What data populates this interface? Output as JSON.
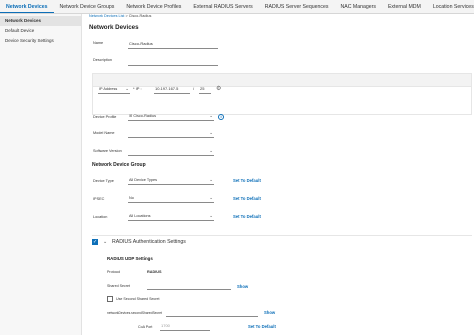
{
  "tabs": [
    "Network Devices",
    "Network Device Groups",
    "Network Device Profiles",
    "External RADIUS Servers",
    "RADIUS Server Sequences",
    "NAC Managers",
    "External MDM",
    "Location Services"
  ],
  "sidebar": {
    "items": [
      "Network Devices",
      "Default Device",
      "Device Security Settings"
    ]
  },
  "breadcrumb": {
    "link": "Network Devices List",
    "sep": ">",
    "current": "Cisco-Radius"
  },
  "page_title": "Network Devices",
  "form": {
    "name_label": "Name",
    "name_value": "Cisco-Radius",
    "description_label": "Description",
    "description_value": "",
    "ip": {
      "type": "IP Address",
      "sep": "* IP :",
      "address": "10.197.167.5",
      "slash": "/",
      "mask": "25"
    },
    "device_profile_label": "Device Profile",
    "device_profile_value": "Cisco-Radius",
    "model_name_label": "Model Name",
    "software_version_label": "Software Version"
  },
  "ndg": {
    "title": "Network Device Group",
    "device_type_label": "Device Type",
    "device_type_value": "All Device Types",
    "ipsec_label": "IPSEC",
    "ipsec_value": "No",
    "location_label": "Location",
    "location_value": "All Locations",
    "set_default": "Set To Default"
  },
  "radius": {
    "section_title": "RADIUS Authentication Settings",
    "udp_title": "RADIUS UDP Settings",
    "protocol_label": "Protocol",
    "protocol_value": "RADIUS",
    "shared_secret_label": "Shared Secret",
    "shared_secret_value": "",
    "show": "Show",
    "second_secret_label": "Use Second Shared Secret",
    "second_secret_field": "networkDevices.secondSharedSecret",
    "coa_port_label": "CoA Port",
    "coa_port_value": "1700",
    "set_default": "Set To Default"
  },
  "colors": {
    "accent": "#0d6fb8"
  }
}
